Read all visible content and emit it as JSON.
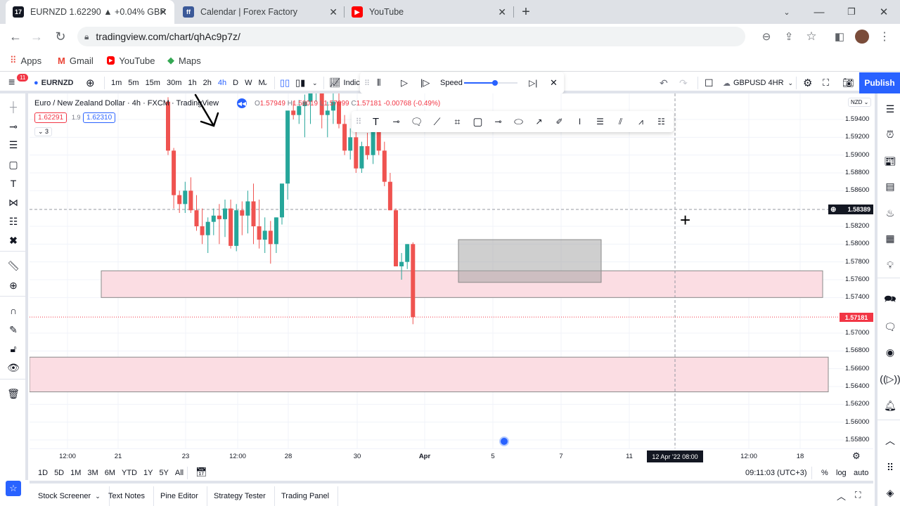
{
  "browser": {
    "tabs": [
      {
        "title": "EURNZD 1.62290 ▲ +0.04% GBP",
        "icon": "tradingview-icon",
        "active": true
      },
      {
        "title": "Calendar | Forex Factory",
        "icon": "forexfactory-icon",
        "active": false
      },
      {
        "title": "YouTube",
        "icon": "youtube-icon",
        "active": false
      }
    ],
    "new_tab": "+",
    "url": "tradingview.com/chart/qhAc9p7z/",
    "bookmarks": [
      {
        "label": "Apps",
        "icon": "apps-grid-icon"
      },
      {
        "label": "Gmail",
        "icon": "gmail-icon"
      },
      {
        "label": "YouTube",
        "icon": "youtube-icon"
      },
      {
        "label": "Maps",
        "icon": "maps-icon"
      }
    ]
  },
  "header": {
    "notification_count": "11",
    "symbol": "EURNZD",
    "intervals": [
      "1m",
      "5m",
      "15m",
      "30m",
      "1h",
      "2h",
      "4h",
      "D",
      "W",
      "M"
    ],
    "active_interval": "4h",
    "indicators_label": "Indic",
    "replay": {
      "speed_label": "Speed",
      "speed_value": 0.58
    },
    "layout_name": "GBPUSD 4HR",
    "publish_label": "Publish",
    "accent": "#2962ff"
  },
  "legend": {
    "title": "Euro / New Zealand Dollar · 4h · FXCM · TradingView",
    "ohlc": {
      "o": "1.57949",
      "h": "1.58019",
      "l": "1.57099",
      "c": "1.57181",
      "chg": "-0.00768 (-0.49%)"
    },
    "bid": "1.62291",
    "spread": "1.9",
    "ask": "1.62310",
    "collapse_count": "3"
  },
  "price_axis": {
    "currency": "NZD",
    "ticks": [
      "1.59400",
      "1.59200",
      "1.59000",
      "1.58800",
      "1.58600",
      "1.58200",
      "1.58000",
      "1.57800",
      "1.57600",
      "1.57400",
      "1.57000",
      "1.56800",
      "1.56600",
      "1.56400",
      "1.56200",
      "1.56000",
      "1.55800"
    ],
    "crosshair_price": "1.58389",
    "last_price": "1.57181"
  },
  "time_axis": {
    "ticks": [
      "12:00",
      "21",
      "23",
      "12:00",
      "28",
      "30",
      "Apr",
      "5",
      "7",
      "11",
      "12:00",
      "18"
    ],
    "crosshair_time": "12 Apr '22  08:00"
  },
  "bottom_bar": {
    "ranges": [
      "1D",
      "5D",
      "1M",
      "3M",
      "6M",
      "YTD",
      "1Y",
      "5Y",
      "All"
    ],
    "clock": "09:11:03 (UTC+3)",
    "percent": "%",
    "log": "log",
    "auto": "auto"
  },
  "panel_tabs": [
    "Stock Screener",
    "Text Notes",
    "Pine Editor",
    "Strategy Tester",
    "Trading Panel"
  ],
  "colors": {
    "up": "#26a69a",
    "down": "#ef5350",
    "zone": "#fbdde3",
    "box": "#c8c8c8"
  },
  "chart_data": {
    "type": "candlestick",
    "ylim": [
      1.557,
      1.596
    ],
    "candles": [
      [
        1.596,
        1.5965,
        1.59,
        1.5905
      ],
      [
        1.5905,
        1.5908,
        1.584,
        1.5855
      ],
      [
        1.5855,
        1.586,
        1.5835,
        1.5845
      ],
      [
        1.5845,
        1.587,
        1.5835,
        1.586
      ],
      [
        1.586,
        1.5875,
        1.5835,
        1.5838
      ],
      [
        1.5838,
        1.5855,
        1.5815,
        1.582
      ],
      [
        1.582,
        1.584,
        1.58,
        1.581
      ],
      [
        1.581,
        1.583,
        1.579,
        1.5825
      ],
      [
        1.5825,
        1.584,
        1.581,
        1.5832
      ],
      [
        1.5832,
        1.5845,
        1.58,
        1.5828
      ],
      [
        1.5828,
        1.585,
        1.5808,
        1.584
      ],
      [
        1.584,
        1.585,
        1.5795,
        1.5798
      ],
      [
        1.5798,
        1.5845,
        1.5792,
        1.5838
      ],
      [
        1.5838,
        1.5848,
        1.581,
        1.5832
      ],
      [
        1.5832,
        1.586,
        1.5812,
        1.5848
      ],
      [
        1.5848,
        1.5868,
        1.58,
        1.582
      ],
      [
        1.582,
        1.585,
        1.5795,
        1.5805
      ],
      [
        1.5805,
        1.583,
        1.579,
        1.5815
      ],
      [
        1.5815,
        1.5826,
        1.5778,
        1.58
      ],
      [
        1.58,
        1.583,
        1.579,
        1.583
      ],
      [
        1.583,
        1.5866,
        1.5822,
        1.5868
      ],
      [
        1.5868,
        1.5935,
        1.585,
        1.595
      ],
      [
        1.595,
        1.596,
        1.594,
        1.5945
      ],
      [
        1.5945,
        1.5962,
        1.5935,
        1.5955
      ],
      [
        1.5955,
        1.5968,
        1.592,
        1.596
      ],
      [
        1.596,
        1.598,
        1.5935,
        1.597
      ],
      [
        1.597,
        1.598,
        1.596,
        1.5975
      ],
      [
        1.5975,
        1.5985,
        1.593,
        1.5945
      ],
      [
        1.5945,
        1.596,
        1.592,
        1.595
      ],
      [
        1.595,
        1.597,
        1.5935,
        1.596
      ],
      [
        1.596,
        1.597,
        1.593,
        1.5935
      ],
      [
        1.5935,
        1.5945,
        1.59,
        1.5905
      ],
      [
        1.5905,
        1.593,
        1.5895,
        1.592
      ],
      [
        1.592,
        1.593,
        1.588,
        1.5885
      ],
      [
        1.5885,
        1.5915,
        1.588,
        1.591
      ],
      [
        1.591,
        1.5925,
        1.5895,
        1.59
      ],
      [
        1.59,
        1.594,
        1.589,
        1.5935
      ],
      [
        1.5935,
        1.5945,
        1.59,
        1.5905
      ],
      [
        1.5905,
        1.5915,
        1.5865,
        1.587
      ],
      [
        1.587,
        1.588,
        1.5838,
        1.5838
      ],
      [
        1.5838,
        1.584,
        1.5775,
        1.5775
      ],
      [
        1.5775,
        1.579,
        1.576,
        1.578
      ],
      [
        1.578,
        1.58,
        1.5772,
        1.58
      ],
      [
        1.58,
        1.5802,
        1.571,
        1.5718
      ]
    ],
    "zones": [
      {
        "name": "demand-zone-upper",
        "top": 1.577,
        "bottom": 1.574
      },
      {
        "name": "demand-zone-lower",
        "top": 1.5673,
        "bottom": 1.5634
      },
      {
        "name": "highlight-box",
        "top": 1.5805,
        "bottom": 1.5757
      }
    ]
  }
}
